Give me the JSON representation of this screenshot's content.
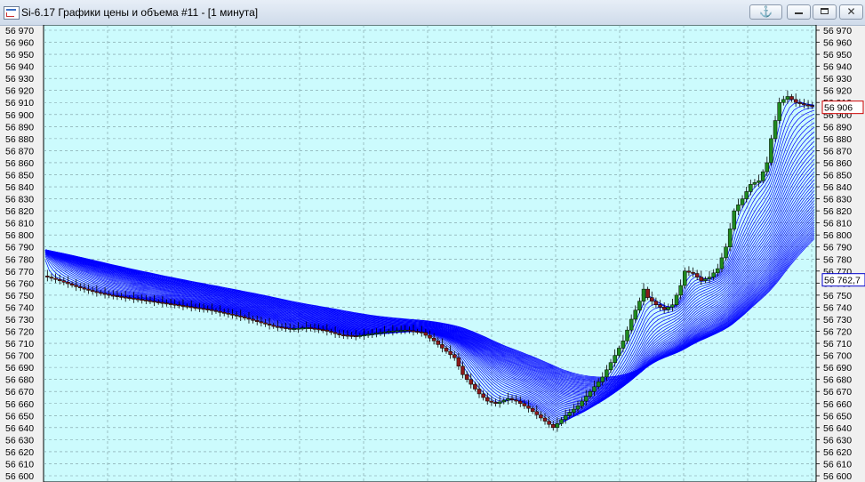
{
  "window": {
    "title": "Si-6.17 Графики цены и объема #11 - [1 минута]",
    "anchor_glyph": "⚓",
    "close_glyph": "✕"
  },
  "colors": {
    "background": "#ccfbfd",
    "grid": "#7a9aa0",
    "ma_lines": "#0000ff",
    "candle_up": "#1f8a1f",
    "candle_down": "#8b1a1a",
    "last_price_label": "#cc0000",
    "ma_label": "#0000cc"
  },
  "chart_data": {
    "type": "candlestick",
    "title": "",
    "ylim": [
      56600,
      56970
    ],
    "y_tick_step": 10,
    "y_tick_labels": [
      "56 970",
      "56 960",
      "56 950",
      "56 940",
      "56 930",
      "56 920",
      "56 910",
      "56 900",
      "56 890",
      "56 880",
      "56 870",
      "56 860",
      "56 850",
      "56 840",
      "56 830",
      "56 820",
      "56 810",
      "56 800",
      "56 790",
      "56 780",
      "56 770",
      "56 760",
      "56 750",
      "56 740",
      "56 730",
      "56 720",
      "56 710",
      "56 700",
      "56 690",
      "56 680",
      "56 670",
      "56 660",
      "56 650",
      "56 640",
      "56 630",
      "56 620",
      "56 610",
      "56 600"
    ],
    "grid": true,
    "price_points": [
      [
        0,
        56766
      ],
      [
        8,
        56762
      ],
      [
        16,
        56757
      ],
      [
        24,
        56753
      ],
      [
        32,
        56750
      ],
      [
        40,
        56748
      ],
      [
        48,
        56746
      ],
      [
        56,
        56744
      ],
      [
        64,
        56742
      ],
      [
        72,
        56740
      ],
      [
        80,
        56738
      ],
      [
        88,
        56735
      ],
      [
        96,
        56732
      ],
      [
        104,
        56728
      ],
      [
        112,
        56724
      ],
      [
        120,
        56722
      ],
      [
        128,
        56723
      ],
      [
        136,
        56721
      ],
      [
        144,
        56717
      ],
      [
        152,
        56716
      ],
      [
        160,
        56718
      ],
      [
        168,
        56720
      ],
      [
        176,
        56721
      ],
      [
        184,
        56719
      ],
      [
        190,
        56712
      ],
      [
        194,
        56706
      ],
      [
        200,
        56698
      ],
      [
        204,
        56684
      ],
      [
        208,
        56676
      ],
      [
        212,
        56668
      ],
      [
        216,
        56662
      ],
      [
        220,
        56660
      ],
      [
        226,
        56664
      ],
      [
        230,
        56662
      ],
      [
        236,
        56656
      ],
      [
        242,
        56648
      ],
      [
        248,
        56640
      ],
      [
        254,
        56650
      ],
      [
        260,
        56658
      ],
      [
        266,
        56670
      ],
      [
        272,
        56682
      ],
      [
        278,
        56700
      ],
      [
        282,
        56712
      ],
      [
        286,
        56730
      ],
      [
        290,
        56745
      ],
      [
        292,
        56755
      ],
      [
        294,
        56748
      ],
      [
        298,
        56742
      ],
      [
        302,
        56738
      ],
      [
        306,
        56742
      ],
      [
        310,
        56758
      ],
      [
        312,
        56770
      ],
      [
        316,
        56768
      ],
      [
        320,
        56762
      ],
      [
        324,
        56765
      ],
      [
        328,
        56772
      ],
      [
        332,
        56790
      ],
      [
        334,
        56805
      ],
      [
        336,
        56820
      ],
      [
        340,
        56830
      ],
      [
        344,
        56842
      ],
      [
        348,
        56845
      ],
      [
        352,
        56860
      ],
      [
        354,
        56880
      ],
      [
        356,
        56895
      ],
      [
        358,
        56910
      ],
      [
        362,
        56915
      ],
      [
        366,
        56910
      ],
      [
        370,
        56908
      ],
      [
        374,
        56907
      ]
    ],
    "last_price_label": "56 906",
    "last_price": 56906,
    "ma_label": "56 762,7",
    "ma_value": 56762.7
  }
}
